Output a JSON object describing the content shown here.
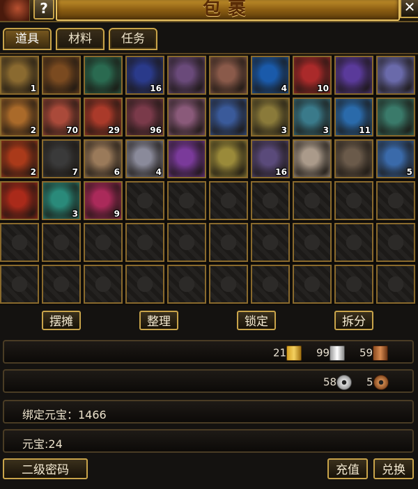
{
  "window": {
    "title": "包裹",
    "help_label": "?",
    "close_label": "✕"
  },
  "tabs": [
    {
      "label": "道具",
      "active": true
    },
    {
      "label": "材料",
      "active": false
    },
    {
      "label": "任务",
      "active": false
    }
  ],
  "slots": [
    {
      "icon": "boots-icon",
      "qty": "1",
      "color": "#8a6a30"
    },
    {
      "icon": "crown-icon",
      "qty": "",
      "color": "#7a4a20"
    },
    {
      "icon": "jade-ring-icon",
      "qty": "",
      "color": "#2a6a50"
    },
    {
      "icon": "comet-scroll-icon",
      "qty": "16",
      "color": "#2a3a8a"
    },
    {
      "icon": "vase-icon",
      "qty": "",
      "color": "#6a4a7a"
    },
    {
      "icon": "pearls-icon",
      "qty": "",
      "color": "#8a5a4a"
    },
    {
      "icon": "rune-scroll-icon",
      "qty": "4",
      "color": "#1a5aaa"
    },
    {
      "icon": "ruby-crystal-icon",
      "qty": "10",
      "color": "#aa2a2a"
    },
    {
      "icon": "spirit-orb-icon",
      "qty": "",
      "color": "#5a3a9a"
    },
    {
      "icon": "light-orbs-icon",
      "qty": "",
      "color": "#6a6aaa"
    },
    {
      "icon": "bread-icon",
      "qty": "2",
      "color": "#aa6a2a"
    },
    {
      "icon": "meat-icon",
      "qty": "70",
      "color": "#aa4a3a"
    },
    {
      "icon": "fruit-icon",
      "qty": "29",
      "color": "#aa3a2a"
    },
    {
      "icon": "slingshot-icon",
      "qty": "96",
      "color": "#7a3a4a"
    },
    {
      "icon": "paper-scroll-icon",
      "qty": "",
      "color": "#8a5a7a"
    },
    {
      "icon": "map-scroll-icon",
      "qty": "",
      "color": "#3a5a9a"
    },
    {
      "icon": "gold-ore-icon",
      "qty": "3",
      "color": "#8a7a3a"
    },
    {
      "icon": "silver-ore-icon",
      "qty": "3",
      "color": "#3a7a8a"
    },
    {
      "icon": "water-bottle-icon",
      "qty": "11",
      "color": "#2a6aaa"
    },
    {
      "icon": "shell-pearl-icon",
      "qty": "",
      "color": "#3a7a6a"
    },
    {
      "icon": "red-scroll-icon",
      "qty": "2",
      "color": "#aa3a1a"
    },
    {
      "icon": "black-stone-icon",
      "qty": "7",
      "color": "#3a3a3a"
    },
    {
      "icon": "cloth-bundle-icon",
      "qty": "6",
      "color": "#9a7a5a"
    },
    {
      "icon": "silver-nugget-icon",
      "qty": "4",
      "color": "#8a8a9a"
    },
    {
      "icon": "purple-carpet-icon",
      "qty": "",
      "color": "#7a3a9a"
    },
    {
      "icon": "gold-carpet-icon",
      "qty": "",
      "color": "#9a8a3a"
    },
    {
      "icon": "coffin-icon",
      "qty": "16",
      "color": "#5a4a7a"
    },
    {
      "icon": "cards-icon",
      "qty": "",
      "color": "#aa9a8a"
    },
    {
      "icon": "bowl-icon",
      "qty": "",
      "color": "#6a5a4a"
    },
    {
      "icon": "dragon-icon",
      "qty": "5",
      "color": "#3a6aaa"
    },
    {
      "icon": "red-pouch-icon",
      "qty": "",
      "color": "#aa2a1a"
    },
    {
      "icon": "green-beads-icon",
      "qty": "3",
      "color": "#2a8a7a"
    },
    {
      "icon": "treasure-chest-icon",
      "qty": "9",
      "color": "#aa2a5a"
    }
  ],
  "actions": {
    "stall": "摆摊",
    "sort": "整理",
    "lock": "锁定",
    "split": "拆分"
  },
  "currency": {
    "gold_book": "21",
    "silver_book": "99",
    "copper_book": "59",
    "silver_coin": "58",
    "copper_coin": "5"
  },
  "info": {
    "bound_yuanbao": "绑定元宝：1466",
    "yuanbao": "元宝:24"
  },
  "bottom": {
    "secondary_password": "二级密码",
    "recharge": "充值",
    "exchange": "兑换"
  }
}
